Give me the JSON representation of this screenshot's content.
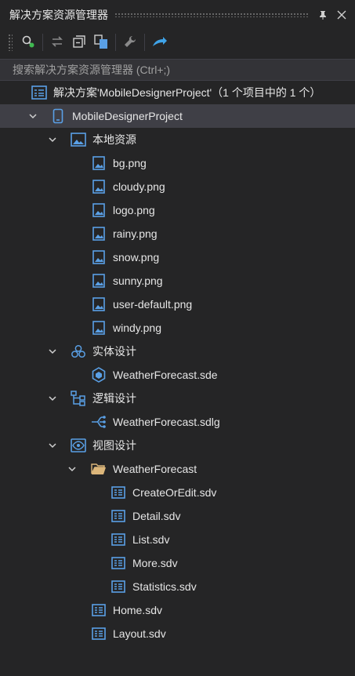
{
  "panel": {
    "title": "解决方案资源管理器",
    "pin_icon": "pin-icon",
    "close_icon": "close-icon"
  },
  "toolbar": {
    "buttons": [
      {
        "name": "sync-icon"
      },
      {
        "name": "switch-views-icon"
      },
      {
        "name": "collapse-all-icon"
      },
      {
        "name": "show-all-files-icon"
      },
      {
        "name": "properties-wrench-icon"
      },
      {
        "name": "preview-arrow-icon"
      }
    ]
  },
  "search": {
    "placeholder": "搜索解决方案资源管理器 (Ctrl+;)"
  },
  "tree": {
    "solution": "解决方案'MobileDesignerProject'（1 个项目中的 1 个）",
    "project": "MobileDesignerProject",
    "local_resources": {
      "label": "本地资源",
      "files": [
        "bg.png",
        "cloudy.png",
        "logo.png",
        "rainy.png",
        "snow.png",
        "sunny.png",
        "user-default.png",
        "windy.png"
      ]
    },
    "entity_design": {
      "label": "实体设计",
      "files": [
        "WeatherForecast.sde"
      ]
    },
    "logic_design": {
      "label": "逻辑设计",
      "files": [
        "WeatherForecast.sdlg"
      ]
    },
    "view_design": {
      "label": "视图设计",
      "folder": {
        "label": "WeatherForecast",
        "files": [
          "CreateOrEdit.sdv",
          "Detail.sdv",
          "List.sdv",
          "More.sdv",
          "Statistics.sdv"
        ]
      },
      "files": [
        "Home.sdv",
        "Layout.sdv"
      ]
    }
  },
  "colors": {
    "background": "#252526",
    "selected_row": "#3f3f46",
    "icon_blue": "#5aa0e6",
    "folder_yellow": "#dcb67a"
  }
}
